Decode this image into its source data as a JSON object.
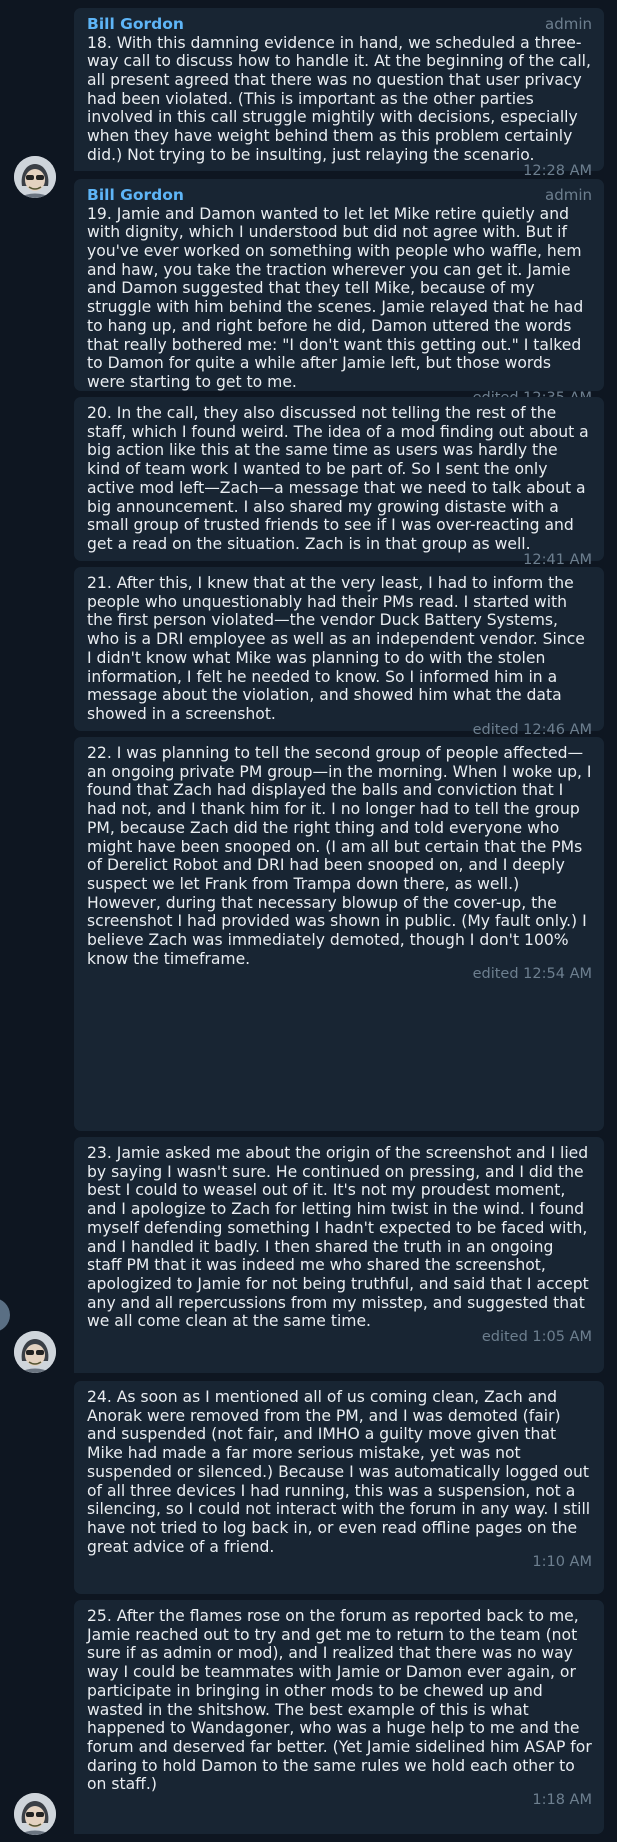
{
  "messages": [
    {
      "sender": "Bill Gordon",
      "role": "admin",
      "text": "18. With this damning evidence in hand, we scheduled a three-way call to discuss how to handle it. At the beginning of the call, all present agreed that there was no question that user privacy had been violated. (This is important as the other parties involved in this call struggle mightily with decisions, especially when they have weight behind them as this problem certainly did.) Not trying to be insulting, just relaying the scenario.",
      "time": "12:28 AM"
    },
    {
      "sender": "Bill Gordon",
      "role": "admin",
      "text": "19. Jamie and Damon wanted to let let Mike retire quietly and with dignity, which I understood but did not agree with. But if you've ever worked on something with people who waffle, hem and haw, you take the traction wherever you can get it. Jamie and Damon suggested that they tell Mike, because of my struggle with him behind the scenes. Jamie relayed that he had to hang up, and right before he did, Damon uttered the words that really bothered me: \"I don't want this getting out.\" I talked to Damon for quite a while after Jamie left, but those words were starting to get to me.",
      "time": "edited 12:35 AM"
    },
    {
      "text": "20. In the call, they also discussed not telling the rest of the staff, which I found weird. The idea of a mod finding out about a big action like this at the same time as users was hardly the kind of team work I wanted to be part of. So I sent the only active mod left—Zach—a message that we need to talk about a big announcement. I also shared my growing distaste with a small group of trusted friends to see if I was over-reacting and get a read on the situation. Zach is in that group as well.",
      "time": "12:41 AM"
    },
    {
      "text": "21. After this, I knew that at the very least, I had to inform the people who unquestionably had their PMs read. I started with the first person violated—the vendor Duck Battery Systems, who is a DRI employee as well as an independent vendor. Since I didn't know what Mike was planning to do with the stolen information, I felt he needed to know. So I informed him in a message about the violation, and showed him what the data showed in a screenshot.",
      "time": "edited 12:46 AM"
    },
    {
      "text": "22. I was planning to tell the second group of people affected—an ongoing private PM group—in the morning. When I woke up, I found that Zach had displayed the balls and conviction that I had not, and I thank him for it. I no longer had to tell the group PM, because Zach did the right thing and told everyone who might have been snooped on. (I am all but certain that the PMs of Derelict Robot and DRI had been snooped on, and I deeply suspect we let Frank from Trampa down there, as well.) However, during that necessary blowup of the cover-up, the screenshot I had provided was shown in public. (My fault only.) I believe Zach was immediately demoted, though I don't 100% know the timeframe.",
      "time": "edited 12:54 AM"
    },
    {
      "text": "23. Jamie asked me about the origin of the screenshot and I lied by saying I wasn't sure. He continued on pressing, and I did the best I could to weasel out of it. It's not my proudest moment, and I apologize to Zach for letting him twist in the wind. I found myself defending something I hadn't expected to be faced with, and I handled it badly. I then shared the truth in an ongoing staff PM that it was indeed me who shared the screenshot, apologized to Jamie for not being truthful,  and said that I accept any and all repercussions from my misstep, and suggested that we all come clean at the same time.",
      "time": "edited 1:05 AM"
    },
    {
      "text": "24. As soon as I mentioned all of us coming clean, Zach and Anorak were removed from the PM, and I was demoted (fair) and suspended (not fair, and IMHO a guilty move given that Mike had made a far more serious  mistake, yet was not suspended or silenced.)  Because I was automatically logged out of all three devices I had running, this was a suspension, not a silencing, so I could not interact with the forum in any way. I still have not tried to log back in, or even read offline pages on the great advice of a friend.",
      "time": "1:10 AM"
    },
    {
      "text": "25. After the flames rose on the forum as reported back to me, Jamie reached out to try and get me to return to the team (not sure if as admin or mod), and I realized that there was no way way I could be teammates with Jamie or Damon ever again, or participate in bringing in other mods to be chewed up and wasted in the shitshow. The best example of this is what happened to Wandagoner, who was a huge help to me and the forum and deserved far better. (Yet Jamie sidelined him ASAP for daring to hold Damon to the same rules we hold each other to on staff.)",
      "time": "1:18 AM"
    }
  ]
}
